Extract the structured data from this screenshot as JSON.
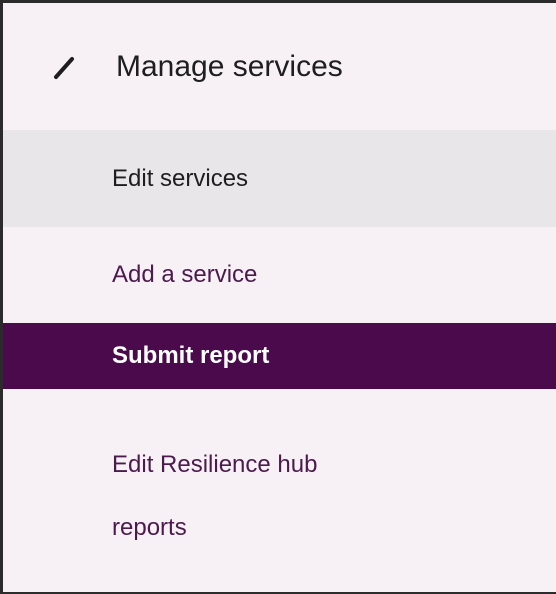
{
  "sidebar": {
    "section": {
      "icon": "pencil-icon",
      "title": "Manage services"
    },
    "items": [
      {
        "label": "Edit services",
        "state": "selected"
      },
      {
        "label": "Add a service",
        "state": "link"
      },
      {
        "label": "Submit report",
        "state": "active"
      },
      {
        "label_lines": [
          "Edit Resilience hub",
          "reports"
        ],
        "state": "link"
      }
    ]
  },
  "colors": {
    "panel_background": "#f7f1f6",
    "selected_background": "#e8e6e8",
    "active_background": "#4a0a4c",
    "link_text": "#4c1a4d",
    "primary_text": "#1e1e1e"
  }
}
